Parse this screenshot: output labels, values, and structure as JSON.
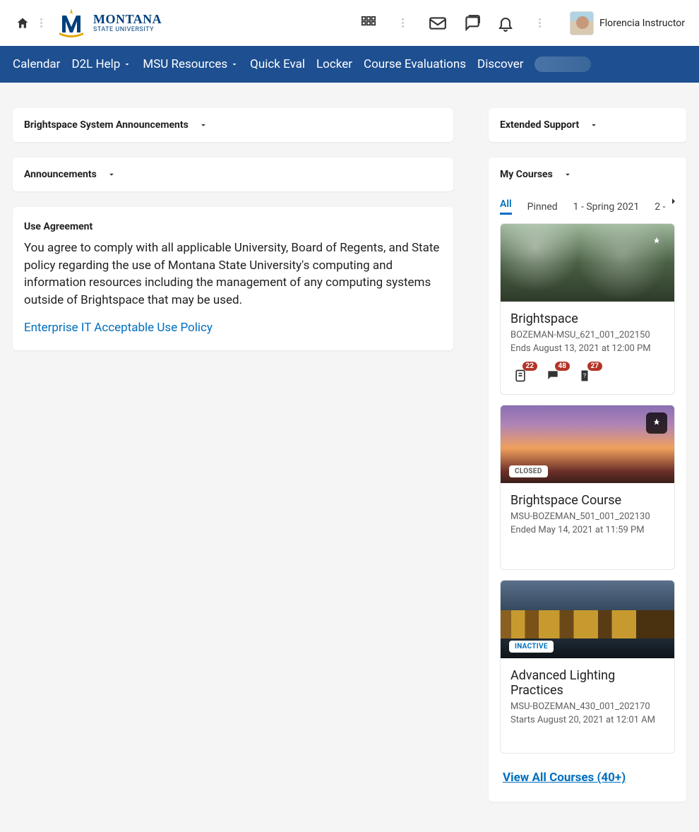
{
  "org": {
    "name_main": "MONTANA",
    "name_sub": "STATE UNIVERSITY"
  },
  "user": {
    "name": "Florencia Instructor"
  },
  "nav": {
    "items": [
      {
        "label": "Calendar",
        "dropdown": false
      },
      {
        "label": "D2L Help",
        "dropdown": true
      },
      {
        "label": "MSU Resources",
        "dropdown": true
      },
      {
        "label": "Quick Eval",
        "dropdown": false
      },
      {
        "label": "Locker",
        "dropdown": false
      },
      {
        "label": "Course Evaluations",
        "dropdown": false
      },
      {
        "label": "Discover",
        "dropdown": false
      }
    ]
  },
  "widgets": {
    "sys_announcements": {
      "title": "Brightspace System Announcements"
    },
    "announcements": {
      "title": "Announcements"
    },
    "use_agreement": {
      "title": "Use Agreement",
      "body": "You agree to comply with all applicable University, Board of Regents, and State policy regarding the use of Montana State University's computing and information resources including the management of any computing systems outside of Brightspace that may be used.",
      "link_label": "Enterprise IT Acceptable Use Policy"
    },
    "extended_support": {
      "title": "Extended Support"
    },
    "my_courses": {
      "title": "My Courses",
      "tabs": [
        "All",
        "Pinned",
        "1 - Spring 2021",
        "2 -"
      ],
      "active_tab": 0,
      "courses": [
        {
          "title": "Brightspace",
          "code": "BOZEMAN-MSU_621_001_202150",
          "date": "Ends August 13, 2021 at 12:00 PM",
          "image": "forest",
          "pinned": true,
          "pin_style": "light",
          "badges": {
            "assignments": 22,
            "discussions": 48,
            "quizzes": 27
          }
        },
        {
          "title": "Brightspace Course",
          "code": "MSU-BOZEMAN_501_001_202130",
          "date": "Ended May 14, 2021 at 11:59 PM",
          "image": "sunset",
          "status": "CLOSED",
          "pinned": true,
          "pin_style": "dark"
        },
        {
          "title": "Advanced Lighting Practices",
          "code": "MSU-BOZEMAN_430_001_202170",
          "date": "Starts August 20, 2021 at 12:01 AM",
          "image": "trees",
          "status": "INACTIVE"
        }
      ],
      "view_all_label": "View All Courses (40+)"
    }
  }
}
